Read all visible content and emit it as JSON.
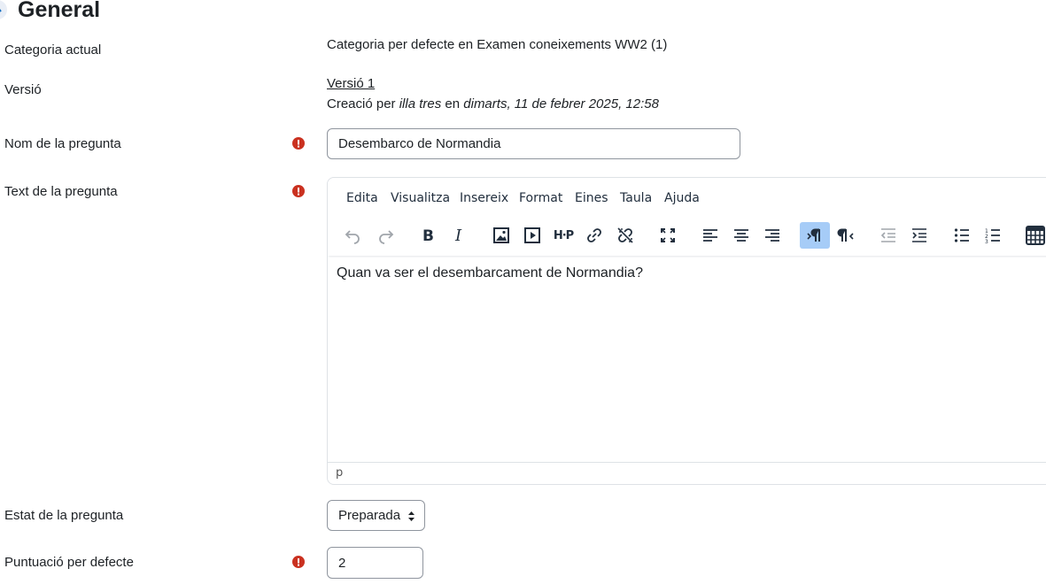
{
  "section": {
    "title": "General"
  },
  "fields": {
    "category": {
      "label": "Categoria actual",
      "value": "Categoria per defecte en Examen coneixements WW2 (1)"
    },
    "version": {
      "label": "Versió",
      "link": "Versió 1",
      "created_prefix": "Creació per",
      "created_user": "illa tres",
      "created_mid": "en",
      "created_date": "dimarts, 11 de febrer 2025, 12:58"
    },
    "name": {
      "label": "Nom de la pregunta",
      "value": "Desembarco de Normandia"
    },
    "text": {
      "label": "Text de la pregunta"
    },
    "status": {
      "label": "Estat de la pregunta",
      "value": "Preparada"
    },
    "points": {
      "label": "Puntuació per defecte",
      "value": "2"
    }
  },
  "editor": {
    "menu": [
      "Edita",
      "Visualitza",
      "Insereix",
      "Format",
      "Eines",
      "Taula",
      "Ajuda"
    ],
    "toolbar": [
      "undo-icon",
      "redo-icon",
      "bold-icon",
      "italic-icon",
      "image-icon",
      "media-icon",
      "h5p-icon",
      "link-icon",
      "unlink-icon",
      "fullscreen-icon",
      "align-left-icon",
      "align-center-icon",
      "align-right-icon",
      "ltr-icon",
      "rtl-icon",
      "outdent-icon",
      "indent-icon",
      "bullet-list-icon",
      "numbered-list-icon",
      "calculator-icon"
    ],
    "h5p_label": "H·P",
    "content": "Quan va ser el desembarcament de Normandia?",
    "status_path": "p"
  },
  "colors": {
    "required": "#ca3120",
    "active_button": "#a6ccf7",
    "text": "#1d2125"
  }
}
